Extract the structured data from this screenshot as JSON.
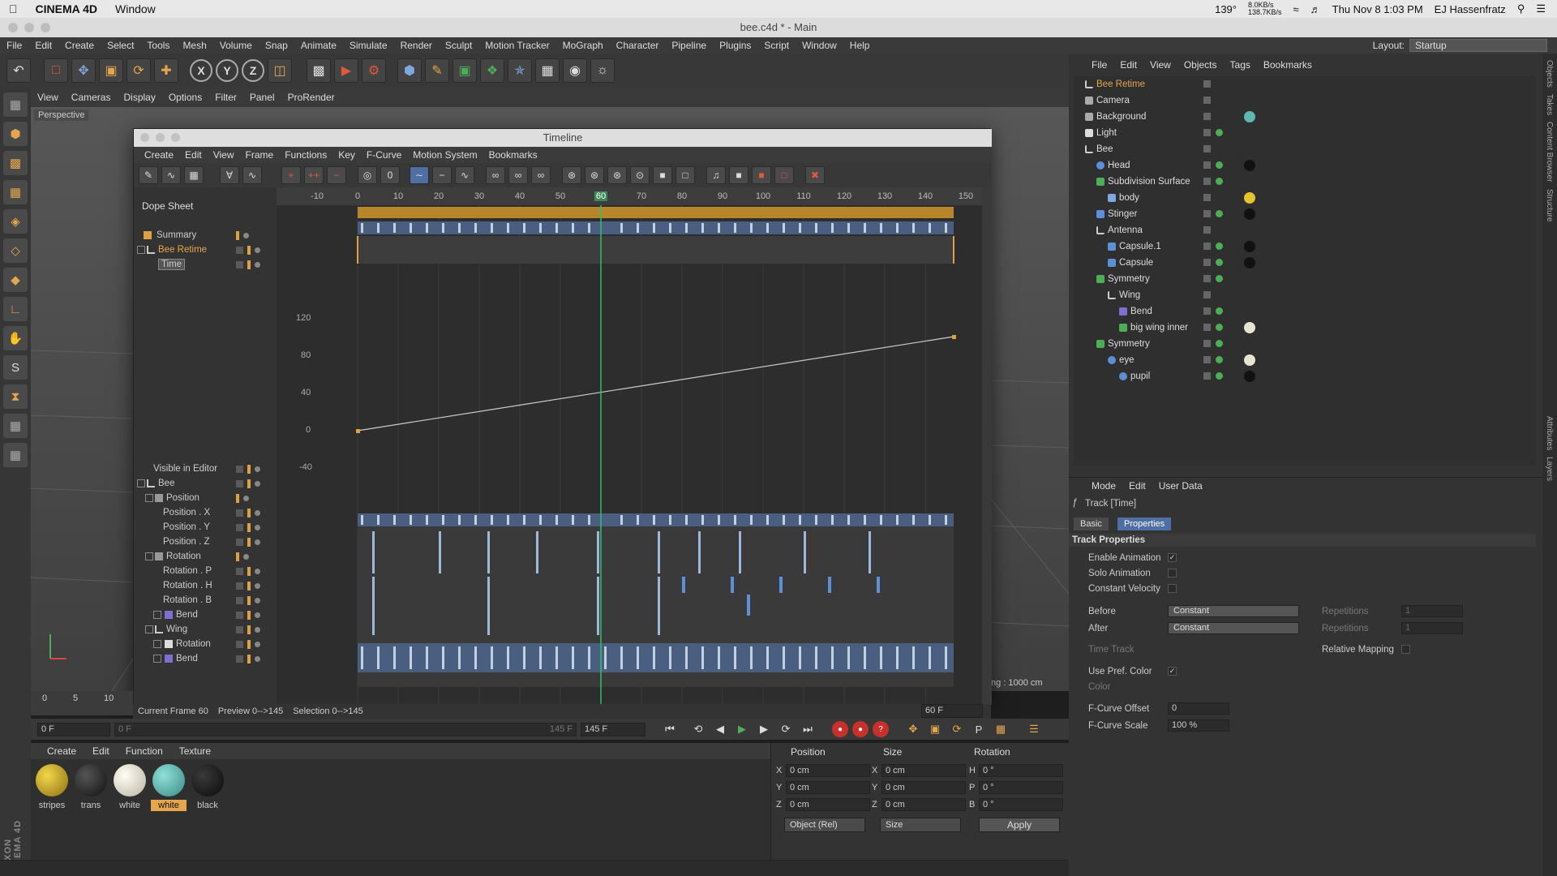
{
  "mac_menubar": {
    "app": "CINEMA 4D",
    "menu": "Window",
    "status": [
      "139°",
      "8.0KB/s",
      "138.7KB/s",
      "Thu Nov 8  1:03 PM",
      "EJ Hassenfratz"
    ]
  },
  "window_title": "bee.c4d * - Main",
  "app_menu": [
    "File",
    "Edit",
    "Create",
    "Select",
    "Tools",
    "Mesh",
    "Volume",
    "Snap",
    "Animate",
    "Simulate",
    "Render",
    "Sculpt",
    "Motion Tracker",
    "MoGraph",
    "Character",
    "Pipeline",
    "Plugins",
    "Script",
    "Window",
    "Help"
  ],
  "layout": {
    "label": "Layout:",
    "value": "Startup"
  },
  "toolbar_icons": [
    "undo-icon",
    "select-icon",
    "move-icon",
    "scale-icon",
    "rotate-icon",
    "add-icon",
    "x-axis-icon",
    "y-axis-icon",
    "z-axis-icon",
    "world-icon",
    "render-view-icon",
    "render-icon",
    "render-settings-icon",
    "cube-icon",
    "pen-icon",
    "subdivision-icon",
    "array-icon",
    "deformer-icon",
    "floor-icon",
    "camera-icon",
    "light-icon"
  ],
  "axis_labels": [
    "X",
    "Y",
    "Z"
  ],
  "viewport": {
    "menu": [
      "View",
      "Cameras",
      "Display",
      "Options",
      "Filter",
      "Panel",
      "ProRender"
    ],
    "label": "Perspective",
    "grid_spacing": "ng : 1000 cm",
    "scale": [
      "0",
      "5",
      "10"
    ]
  },
  "timeline": {
    "title": "Timeline",
    "menu": [
      "Create",
      "Edit",
      "View",
      "Frame",
      "Functions",
      "Key",
      "F-Curve",
      "Motion System",
      "Bookmarks"
    ],
    "mode_label": "Dope Sheet",
    "ruler": [
      "-10",
      "0",
      "10",
      "20",
      "30",
      "40",
      "50",
      "60",
      "70",
      "80",
      "90",
      "100",
      "110",
      "120",
      "130",
      "140",
      "150"
    ],
    "value_axis": [
      "120",
      "80",
      "40",
      "0",
      "-40"
    ],
    "current_frame_field": "60 F",
    "tree": [
      {
        "label": "Summary"
      },
      {
        "label": "Bee Retime"
      },
      {
        "label": "Time"
      },
      {
        "label": "Visible in Editor"
      },
      {
        "label": "Bee"
      },
      {
        "label": "Position"
      },
      {
        "label": "Position . X"
      },
      {
        "label": "Position . Y"
      },
      {
        "label": "Position . Z"
      },
      {
        "label": "Rotation"
      },
      {
        "label": "Rotation . P"
      },
      {
        "label": "Rotation . H"
      },
      {
        "label": "Rotation . B"
      },
      {
        "label": "Bend"
      },
      {
        "label": "Wing"
      },
      {
        "label": "Rotation"
      },
      {
        "label": "Bend"
      }
    ],
    "status": {
      "current_frame": "Current Frame  60",
      "preview": "Preview  0-->145",
      "selection": "Selection  0-->145"
    }
  },
  "transport": {
    "start": "0 F",
    "range_start": "0 F",
    "range_end": "145 F",
    "end": "145 F"
  },
  "materials": {
    "menu": [
      "Create",
      "Edit",
      "Function",
      "Texture"
    ],
    "items": [
      {
        "name": "stripes",
        "color": "#c9a520"
      },
      {
        "name": "trans",
        "color": "#2a2a2a"
      },
      {
        "name": "white",
        "color": "#e8e4d0"
      },
      {
        "name": "white",
        "color": "#5fb8b0"
      },
      {
        "name": "black",
        "color": "#1a1a1a"
      }
    ]
  },
  "coordinates": {
    "headers": [
      "Position",
      "Size",
      "Rotation"
    ],
    "rows": [
      {
        "a": "X",
        "pos": "0 cm",
        "b": "X",
        "size": "0 cm",
        "c": "H",
        "rot": "0 °"
      },
      {
        "a": "Y",
        "pos": "0 cm",
        "b": "Y",
        "size": "0 cm",
        "c": "P",
        "rot": "0 °"
      },
      {
        "a": "Z",
        "pos": "0 cm",
        "b": "Z",
        "size": "0 cm",
        "c": "B",
        "rot": "0 °"
      }
    ],
    "mode": "Object (Rel)",
    "size_mode": "Size",
    "apply": "Apply"
  },
  "object_manager": {
    "menu": [
      "File",
      "Edit",
      "View",
      "Objects",
      "Tags",
      "Bookmarks"
    ],
    "objects": [
      {
        "name": "Bee Retime"
      },
      {
        "name": "Camera"
      },
      {
        "name": "Background"
      },
      {
        "name": "Light"
      },
      {
        "name": "Bee"
      },
      {
        "name": "Head"
      },
      {
        "name": "Subdivision Surface"
      },
      {
        "name": "body"
      },
      {
        "name": "Stinger"
      },
      {
        "name": "Antenna"
      },
      {
        "name": "Capsule.1"
      },
      {
        "name": "Capsule"
      },
      {
        "name": "Symmetry"
      },
      {
        "name": "Wing"
      },
      {
        "name": "Bend"
      },
      {
        "name": "big wing inner"
      },
      {
        "name": "Symmetry"
      },
      {
        "name": "eye"
      },
      {
        "name": "pupil"
      }
    ]
  },
  "attributes": {
    "menu": [
      "Mode",
      "Edit",
      "User Data"
    ],
    "title": "Track [Time]",
    "tabs": [
      "Basic",
      "Properties"
    ],
    "section": "Track Properties",
    "enable_animation": "Enable Animation",
    "solo_animation": "Solo Animation",
    "constant_velocity": "Constant Velocity",
    "before": "Before",
    "after": "After",
    "before_val": "Constant",
    "after_val": "Constant",
    "repetitions": "Repetitions",
    "repetitions_val": "1",
    "time_track": "Time Track",
    "relative_mapping": "Relative Mapping",
    "use_pref_color": "Use Pref. Color",
    "color": "Color",
    "fcurve_offset": "F-Curve Offset",
    "fcurve_offset_val": "0",
    "fcurve_scale": "F-Curve Scale",
    "fcurve_scale_val": "100 %"
  },
  "side_tabs": [
    "Objects",
    "Takes",
    "Content Browser",
    "Structure",
    "Attributes",
    "Layers"
  ]
}
